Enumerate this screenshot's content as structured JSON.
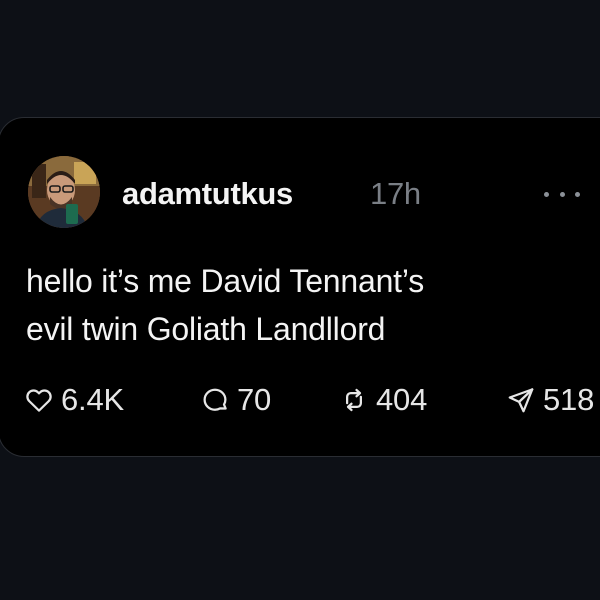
{
  "post": {
    "author": {
      "username": "adamtutkus",
      "timestamp": "17h"
    },
    "text_line_1": "hello it’s me David Tennant’s",
    "text_line_2": "evil twin Goliath Landllord",
    "stats": {
      "likes": "6.4K",
      "replies": "70",
      "reposts": "404",
      "shares": "518"
    },
    "icons": {
      "like": "heart-icon",
      "reply": "comment-icon",
      "repost": "repost-icon",
      "share": "send-icon",
      "more": "more-dots-icon"
    }
  },
  "colors": {
    "background": "#0d1016",
    "card": "#000000",
    "text": "#f4f4f4",
    "muted": "#7a7f86"
  }
}
